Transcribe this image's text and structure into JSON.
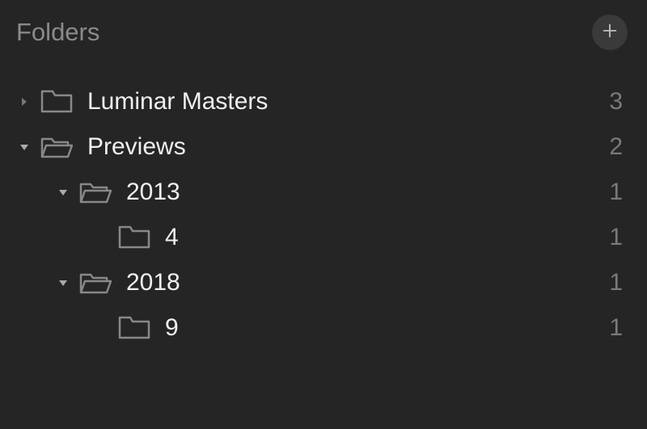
{
  "header": {
    "title": "Folders"
  },
  "tree": {
    "items": [
      {
        "label": "Luminar Masters",
        "count": "3",
        "depth": 0,
        "expanded": false,
        "hasChildren": true,
        "open": false
      },
      {
        "label": "Previews",
        "count": "2",
        "depth": 0,
        "expanded": true,
        "hasChildren": true,
        "open": true
      },
      {
        "label": "2013",
        "count": "1",
        "depth": 1,
        "expanded": true,
        "hasChildren": true,
        "open": true
      },
      {
        "label": "4",
        "count": "1",
        "depth": 2,
        "expanded": false,
        "hasChildren": false,
        "open": false
      },
      {
        "label": "2018",
        "count": "1",
        "depth": 1,
        "expanded": true,
        "hasChildren": true,
        "open": true
      },
      {
        "label": "9",
        "count": "1",
        "depth": 2,
        "expanded": false,
        "hasChildren": false,
        "open": false
      }
    ]
  }
}
